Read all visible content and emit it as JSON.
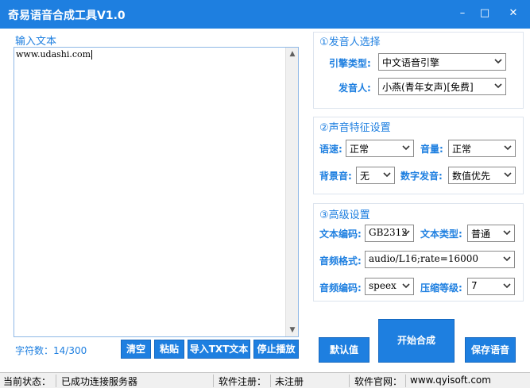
{
  "window": {
    "title": "奇易语音合成工具V1.0",
    "minimize": "–",
    "maximize": "□",
    "close": "✕"
  },
  "input": {
    "heading": "输入文本",
    "text": "www.udashi.com",
    "char_count": "字符数：14/300"
  },
  "speaker": {
    "heading": "①发音人选择",
    "engine_label": "引擎类型:",
    "engine_value": "中文语音引擎",
    "voice_label": "发音人:",
    "voice_value": "小燕(青年女声)[免费]"
  },
  "voice_features": {
    "heading": "②声音特征设置",
    "speed_label": "语速:",
    "speed_value": "正常",
    "volume_label": "音量:",
    "volume_value": "正常",
    "bgm_label": "背景音:",
    "bgm_value": "无",
    "digit_label": "数字发音:",
    "digit_value": "数值优先"
  },
  "advanced": {
    "heading": "③高级设置",
    "encoding_label": "文本编码:",
    "encoding_value": "GB2312",
    "texttype_label": "文本类型:",
    "texttype_value": "普通",
    "format_label": "音频格式:",
    "format_value": "audio/L16;rate=16000",
    "codec_label": "音频编码:",
    "codec_value": "speex",
    "compress_label": "压缩等级:",
    "compress_value": "7"
  },
  "buttons": {
    "clear": "清空",
    "paste": "粘贴",
    "import_txt": "导入TXT文本",
    "stop": "停止播放",
    "default": "默认值",
    "start": "开始合成",
    "save": "保存语音"
  },
  "status": {
    "state_label": "当前状态：",
    "state_value": "已成功连接服务器",
    "reg_label": "软件注册：",
    "reg_value": "未注册",
    "site_label": "软件官网：",
    "site_value": "www.qyisoft.com"
  },
  "colors": {
    "accent": "#1e7fe0"
  }
}
